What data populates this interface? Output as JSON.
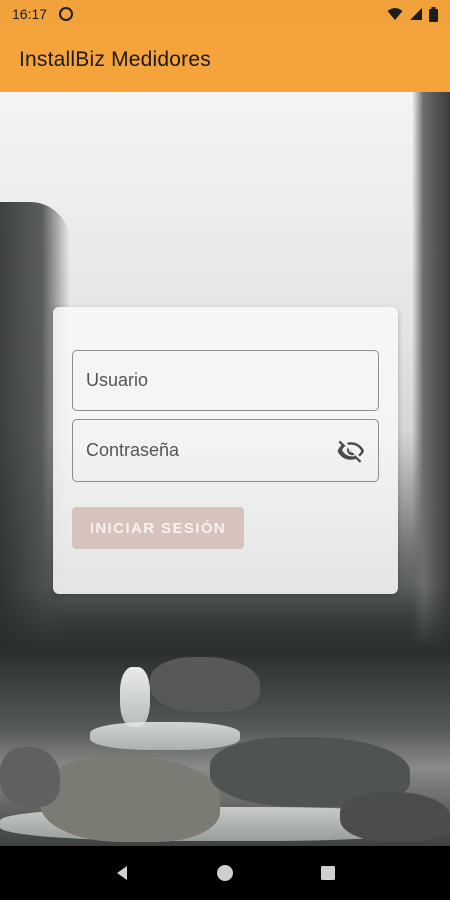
{
  "status_bar": {
    "time": "16:17",
    "icons": [
      "notification-icon",
      "wifi-icon",
      "signal-icon",
      "battery-icon"
    ]
  },
  "app_bar": {
    "title": "InstallBiz Medidores"
  },
  "login_form": {
    "username_placeholder": "Usuario",
    "password_placeholder": "Contraseña",
    "password_toggle_icon": "visibility-off-icon",
    "submit_label": "INICIAR SESIÓN"
  },
  "nav_bar": {
    "icons": [
      "back-icon",
      "home-icon",
      "recents-icon"
    ]
  },
  "colors": {
    "app_bar": "#f5a43c",
    "button": "#d6c3bd",
    "button_text": "#f7f1ef"
  }
}
